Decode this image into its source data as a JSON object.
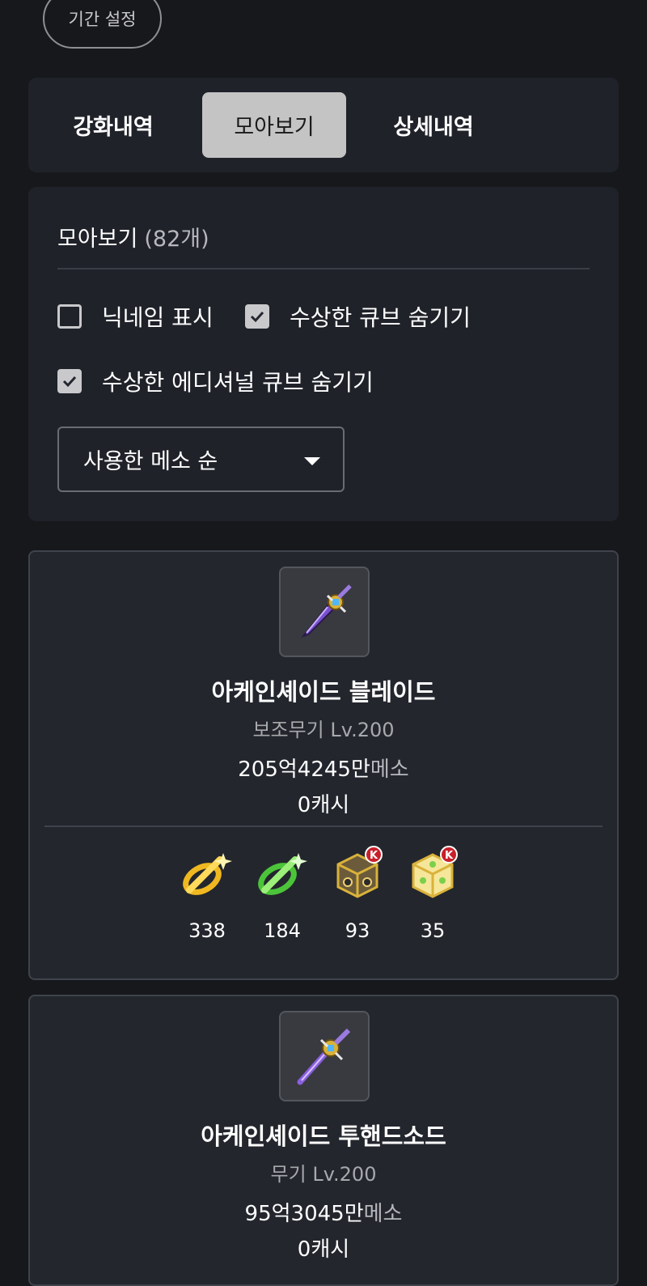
{
  "period_button": "기간 설정",
  "tabs": [
    "강화내역",
    "모아보기",
    "상세내역"
  ],
  "filter": {
    "title": "모아보기",
    "count": "(82개)",
    "options": [
      {
        "label": "닉네임 표시",
        "checked": false
      },
      {
        "label": "수상한 큐브 숨기기",
        "checked": true
      },
      {
        "label": "수상한 에디셔널 큐브 숨기기",
        "checked": true
      }
    ],
    "sort_selected": "사용한 메소 순"
  },
  "items": [
    {
      "name": "아케인셰이드 블레이드",
      "type": "보조무기 Lv.200",
      "meso_amount": "205억4245만",
      "meso_unit": "메소",
      "cash": "0캐시",
      "usage": [
        {
          "icon": "starforce-yellow-icon",
          "count": "338"
        },
        {
          "icon": "starforce-green-icon",
          "count": "184"
        },
        {
          "icon": "black-cube-icon",
          "count": "93"
        },
        {
          "icon": "additional-cube-icon",
          "count": "35"
        }
      ]
    },
    {
      "name": "아케인셰이드 투핸드소드",
      "type": "무기 Lv.200",
      "meso_amount": "95억3045만",
      "meso_unit": "메소",
      "cash": "0캐시"
    }
  ],
  "colors": {
    "background": "#17181c",
    "panel": "#1f2229",
    "card": "#23262d",
    "active_tab": "#c4c4c4"
  }
}
